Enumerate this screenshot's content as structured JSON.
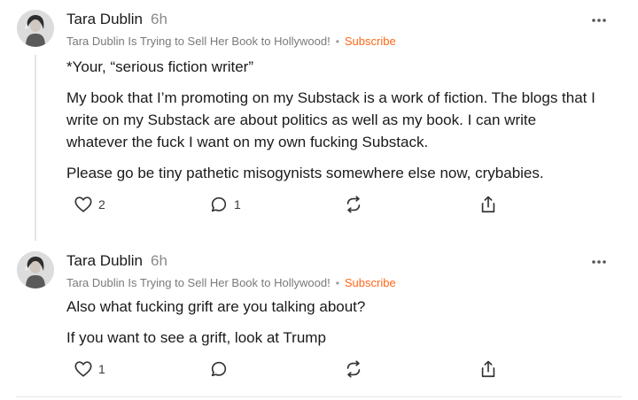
{
  "comments": [
    {
      "author": "Tara Dublin",
      "time": "6h",
      "publication": "Tara Dublin Is Trying to Sell Her Book to Hollywood!",
      "separator": "•",
      "subscribe": "Subscribe",
      "paragraphs": [
        "*Your, “serious fiction writer”",
        "My book that I’m promoting on my Substack is a work of fiction. The blogs that I write on my Substack are about politics as well as my book. I can write whatever the fuck I want on my own fucking Substack.",
        "Please go be tiny pathetic misogynists somewhere else now, crybabies."
      ],
      "likes": "2",
      "replies": "1"
    },
    {
      "author": "Tara Dublin",
      "time": "6h",
      "publication": "Tara Dublin Is Trying to Sell Her Book to Hollywood!",
      "separator": "•",
      "subscribe": "Subscribe",
      "paragraphs": [
        "Also what fucking grift are you talking about?",
        "If you want to see a grift, look at Trump"
      ],
      "likes": "1",
      "replies": ""
    }
  ],
  "icons": {
    "like": "heart-icon",
    "reply": "comment-bubble-icon",
    "restack": "restack-icon",
    "share": "share-icon",
    "more": "more-dots-icon"
  },
  "colors": {
    "accent": "#ff6719",
    "text": "#1a1a1a",
    "muted": "#7a7a7a"
  }
}
